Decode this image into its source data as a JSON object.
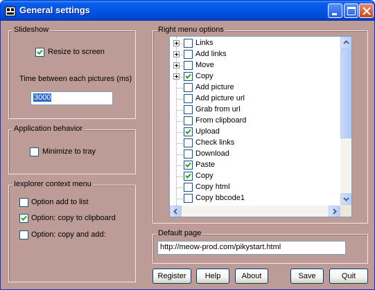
{
  "window": {
    "title": "General settings"
  },
  "slideshow": {
    "title": "Slideshow",
    "resize_label": "Resize to screen",
    "resize_checked": true,
    "time_label": "Time between each pictures (ms)",
    "time_value": "3000"
  },
  "app_behavior": {
    "title": "Application behavior",
    "minimize_label": "Minimize to tray",
    "minimize_checked": false
  },
  "iexplorer": {
    "title": "Iexplorer context menu",
    "options": [
      {
        "label": "Option add to list",
        "checked": false
      },
      {
        "label": "Option: copy to clipboard",
        "checked": true
      },
      {
        "label": "Option: copy and add:",
        "checked": false
      }
    ]
  },
  "right_menu": {
    "title": "Right menu options",
    "items": [
      {
        "label": "Links",
        "checked": false,
        "expandable": true
      },
      {
        "label": "Add links",
        "checked": false,
        "expandable": true
      },
      {
        "label": "Move",
        "checked": false,
        "expandable": true
      },
      {
        "label": "Copy",
        "checked": true,
        "expandable": true
      },
      {
        "label": "Add picture",
        "checked": false,
        "expandable": false
      },
      {
        "label": "Add picture url",
        "checked": false,
        "expandable": false
      },
      {
        "label": "Grab from url",
        "checked": false,
        "expandable": false
      },
      {
        "label": "From clipboard",
        "checked": false,
        "expandable": false
      },
      {
        "label": "Upload",
        "checked": true,
        "expandable": false
      },
      {
        "label": "Check links",
        "checked": false,
        "expandable": false
      },
      {
        "label": "Download",
        "checked": false,
        "expandable": false
      },
      {
        "label": "Paste",
        "checked": true,
        "expandable": false
      },
      {
        "label": "Copy",
        "checked": true,
        "expandable": false
      },
      {
        "label": "Copy html",
        "checked": false,
        "expandable": false
      },
      {
        "label": "Copy bbcode1",
        "checked": false,
        "expandable": false
      }
    ]
  },
  "default_page": {
    "title": "Default page",
    "url": "http://meow-prod.com/pikystart.html"
  },
  "buttons": {
    "register": "Register",
    "help": "Help",
    "about": "About",
    "save": "Save",
    "quit": "Quit"
  }
}
